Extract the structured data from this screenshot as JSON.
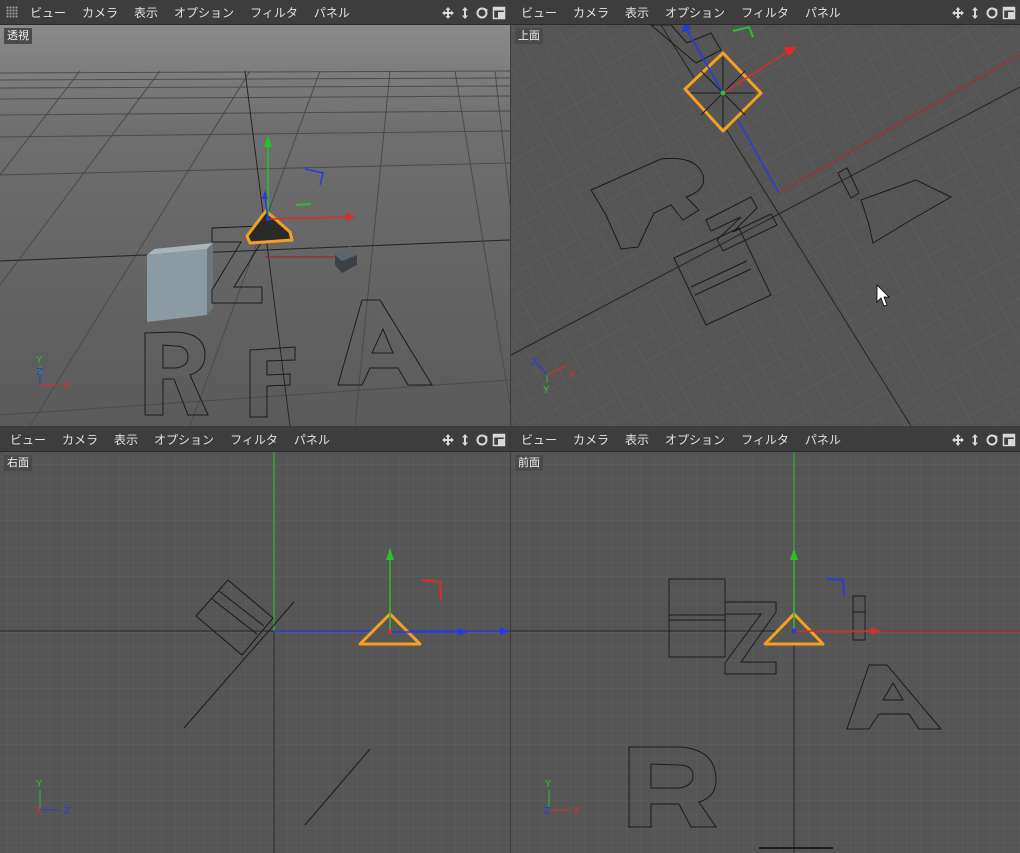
{
  "menu": [
    "ビュー",
    "カメラ",
    "表示",
    "オプション",
    "フィルタ",
    "パネル"
  ],
  "viewports": {
    "perspective": {
      "label": "透視"
    },
    "top": {
      "label": "上面"
    },
    "right": {
      "label": "右面"
    },
    "front": {
      "label": "前面"
    }
  },
  "axes": {
    "x": "X",
    "y": "Y",
    "z": "Z"
  },
  "icons": [
    "grip-icon",
    "move-view-icon",
    "dolly-view-icon",
    "rotate-view-icon",
    "toggle-view-icon"
  ],
  "colors": {
    "axis_x": "#e02a2a",
    "axis_y": "#2ac02a",
    "axis_z": "#2a3ae0",
    "selection": "#f5a020",
    "viewport_bg": "#555555",
    "menubar_bg": "#3d3d3d"
  }
}
